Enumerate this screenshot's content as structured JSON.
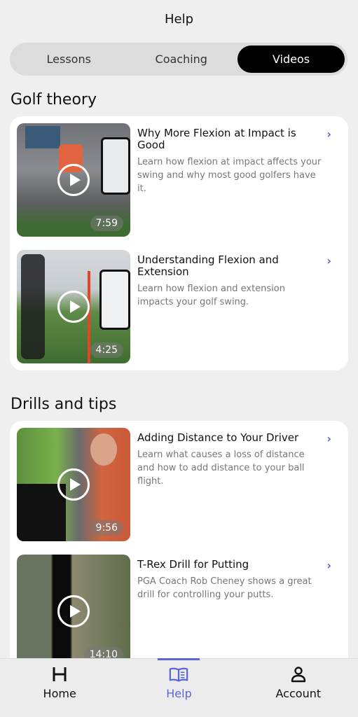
{
  "header": {
    "title": "Help"
  },
  "segments": [
    {
      "label": "Lessons",
      "active": false
    },
    {
      "label": "Coaching",
      "active": false
    },
    {
      "label": "Videos",
      "active": true
    }
  ],
  "sections": [
    {
      "title": "Golf theory",
      "videos": [
        {
          "title": "Why More Flexion at Impact is Good",
          "description": "Learn how flexion at impact affects your swing and why most good golfers have it.",
          "duration": "7:59"
        },
        {
          "title": "Understanding Flexion and Extension",
          "description": "Learn how flexion and extension impacts your golf swing.",
          "duration": "4:25"
        }
      ]
    },
    {
      "title": "Drills and tips",
      "videos": [
        {
          "title": "Adding Distance to Your Driver",
          "description": "Learn what causes a loss of distance and how to add distance to your ball flight.",
          "duration": "9:56"
        },
        {
          "title": "T-Rex Drill for Putting",
          "description": "PGA Coach Rob Cheney shows a great drill for controlling your putts.",
          "duration": "14:10"
        }
      ]
    }
  ],
  "tabbar": {
    "items": [
      {
        "label": "Home",
        "icon": "home-logo-icon",
        "active": false
      },
      {
        "label": "Help",
        "icon": "book-icon",
        "active": true
      },
      {
        "label": "Account",
        "icon": "person-icon",
        "active": false
      }
    ]
  },
  "colors": {
    "accent": "#5a66d8",
    "active_segment": "#000000",
    "background": "#efefef"
  }
}
